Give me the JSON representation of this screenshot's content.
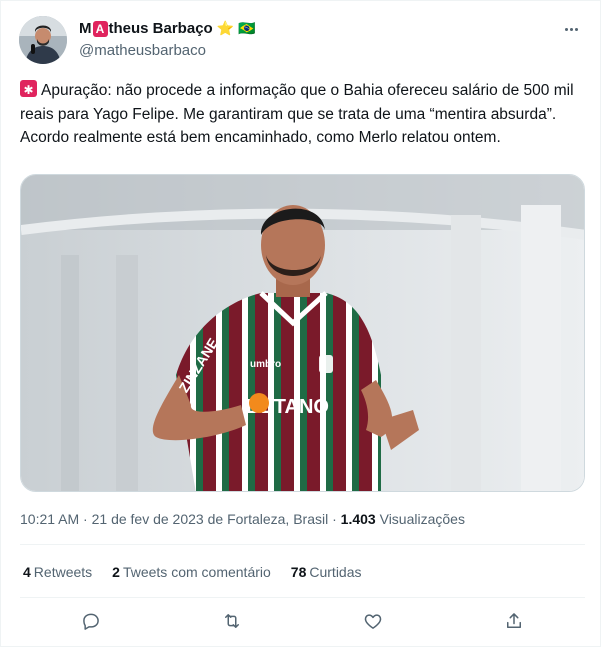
{
  "author": {
    "name_prefix": "M",
    "name_badge_letter": "A",
    "name_rest": "theus Barbaço",
    "handle": "@matheusbarbaco",
    "star_emoji": "⭐",
    "flag_emoji": "🇧🇷"
  },
  "tweet": {
    "text": "Apuração: não procede a informação que o Bahia ofereceu salário de 500 mil reais para Yago Felipe. Me garantiram que se trata de uma “mentira absurda”. Acordo realmente está bem encaminhado, como Merlo relatou ontem."
  },
  "media": {
    "jersey_text_sponsor": "BETANO",
    "jersey_text_sleeve": "ZINZANE",
    "jersey_text_brand": "umbro"
  },
  "meta": {
    "time": "10:21 AM",
    "date": "21 de fev de 2023",
    "location": "de Fortaleza, Brasil",
    "views_count": "1.403",
    "views_label": "Visualizações",
    "separator": "·"
  },
  "stats": {
    "retweets_count": "4",
    "retweets_label": "Retweets",
    "quotes_count": "2",
    "quotes_label": "Tweets com comentário",
    "likes_count": "78",
    "likes_label": "Curtidas"
  },
  "colors": {
    "accent_red": "#e0245e",
    "muted_text": "#536471",
    "jersey_maroon": "#7a1a2a",
    "jersey_green": "#1f6b45"
  },
  "icons": [
    "more-icon",
    "siren-icon",
    "reply-icon",
    "retweet-icon",
    "like-icon",
    "share-icon"
  ]
}
